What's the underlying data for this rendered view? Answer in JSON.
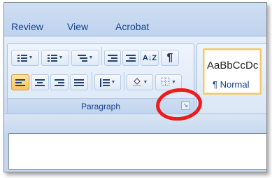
{
  "tabs": [
    "Review",
    "View",
    "Acrobat"
  ],
  "paragraph_group": {
    "label": "Paragraph",
    "launcher_glyph": "↘",
    "row1": [
      {
        "name": "bullets-button",
        "icon": "bullets-icon"
      },
      {
        "name": "numbering-button",
        "icon": "numbering-icon"
      },
      {
        "name": "multilevel-list-button",
        "icon": "multilevel-list-icon"
      },
      {
        "name": "decrease-indent-button",
        "icon": "decrease-indent-icon"
      },
      {
        "name": "increase-indent-button",
        "icon": "increase-indent-icon"
      },
      {
        "name": "sort-button",
        "label": "A↓Z"
      },
      {
        "name": "show-formatting-button",
        "label": "¶"
      }
    ],
    "row2": [
      {
        "name": "align-left-button",
        "icon": "align-left-icon",
        "active": true
      },
      {
        "name": "center-button",
        "icon": "align-center-icon"
      },
      {
        "name": "align-right-button",
        "icon": "align-right-icon"
      },
      {
        "name": "justify-button",
        "icon": "justify-icon"
      },
      {
        "name": "line-spacing-button",
        "icon": "line-spacing-icon"
      },
      {
        "name": "shading-button",
        "icon": "paint-bucket-icon"
      },
      {
        "name": "borders-button",
        "icon": "border-icon"
      }
    ]
  },
  "styles_group": {
    "sample": "AaBbCcDc",
    "style_name": "¶ Normal"
  },
  "colors": {
    "accent_text": "#15428b",
    "active_button": "#f9c35f",
    "annotation_red": "#ee1b1b"
  }
}
